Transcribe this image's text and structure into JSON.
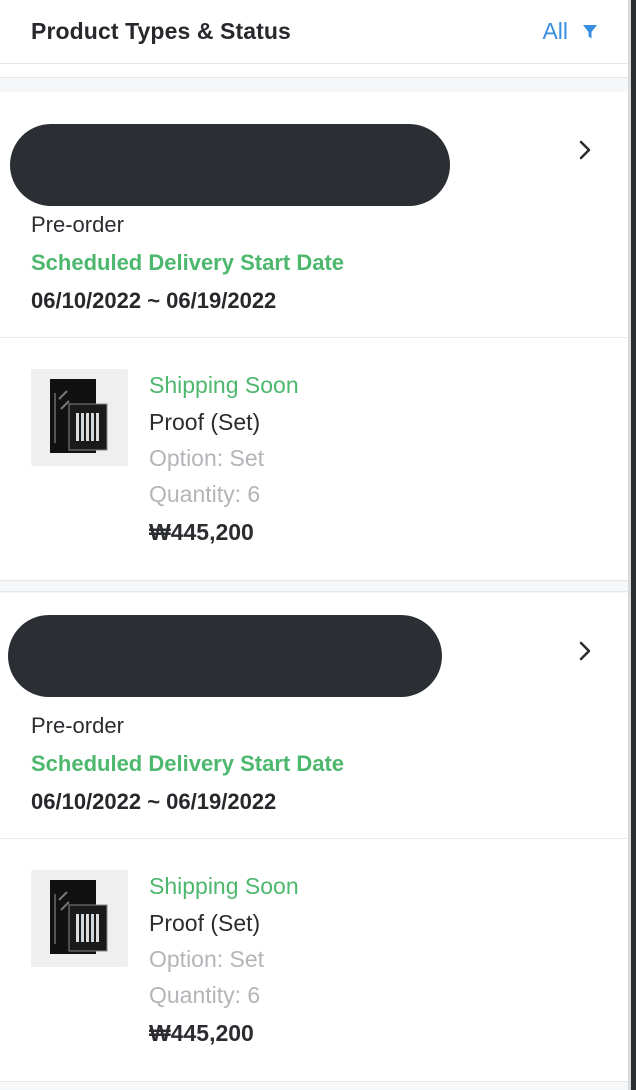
{
  "header": {
    "title": "Product Types & Status",
    "filter_label": "All",
    "filter_icon": "funnel-icon"
  },
  "orders": [
    {
      "type": "Pre-order",
      "schedule_label": "Scheduled Delivery Start Date",
      "date_range": "06/10/2022 ~ 06/19/2022",
      "item": {
        "status": "Shipping Soon",
        "name": "Proof (Set)",
        "option": "Option: Set",
        "quantity": "Quantity: 6",
        "price": "₩445,200"
      }
    },
    {
      "type": "Pre-order",
      "schedule_label": "Scheduled Delivery Start Date",
      "date_range": "06/10/2022 ~ 06/19/2022",
      "item": {
        "status": "Shipping Soon",
        "name": "Proof (Set)",
        "option": "Option: Set",
        "quantity": "Quantity: 6",
        "price": "₩445,200"
      }
    }
  ],
  "colors": {
    "accent_green": "#4db86d",
    "accent_blue": "#3a8ee0",
    "redaction": "#2b2e33"
  }
}
